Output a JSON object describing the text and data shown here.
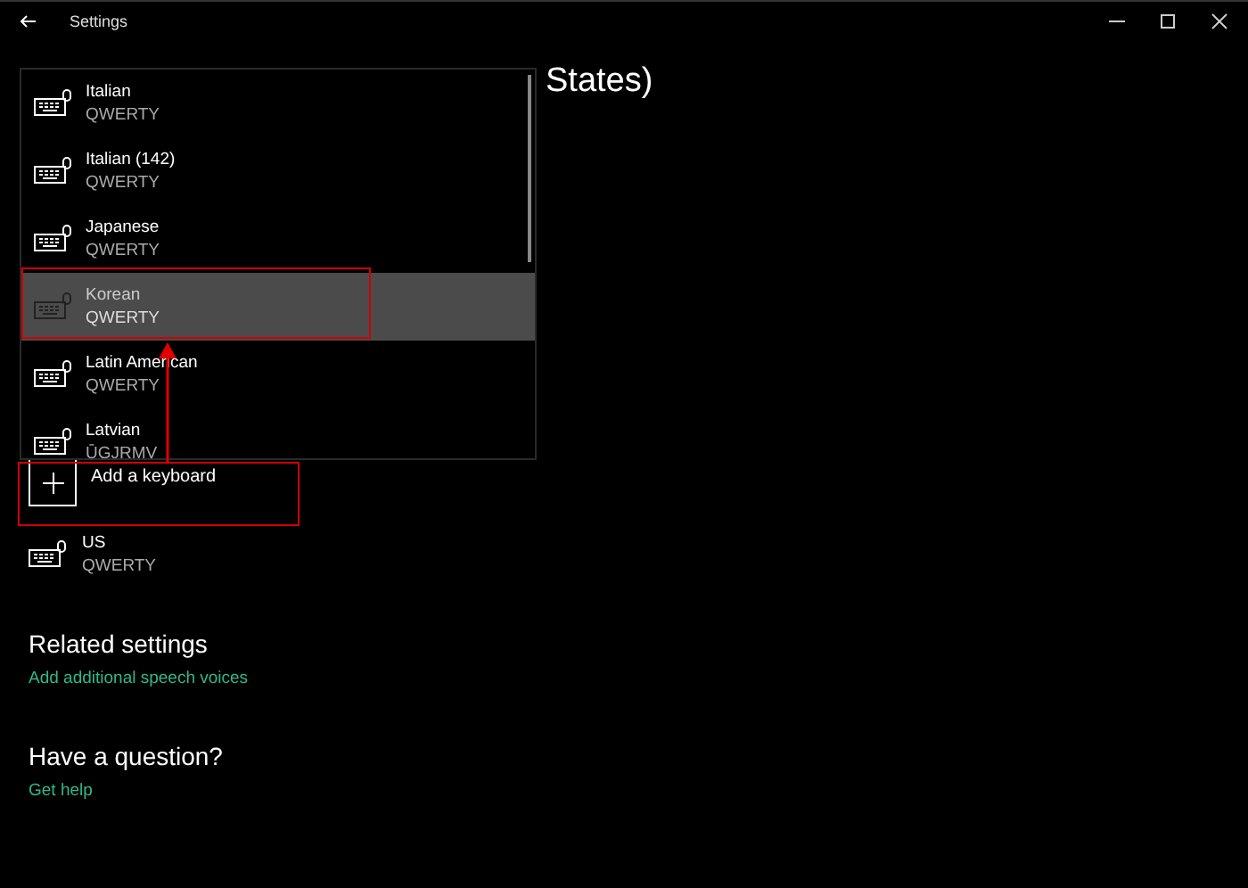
{
  "window": {
    "title": "Settings"
  },
  "page_heading": "States)",
  "keyboard_dropdown": {
    "items": [
      {
        "name": "Italian",
        "layout": "QWERTY",
        "selected": false
      },
      {
        "name": "Italian (142)",
        "layout": "QWERTY",
        "selected": false
      },
      {
        "name": "Japanese",
        "layout": "QWERTY",
        "selected": false
      },
      {
        "name": "Korean",
        "layout": "QWERTY",
        "selected": true
      },
      {
        "name": "Latin American",
        "layout": "QWERTY",
        "selected": false
      },
      {
        "name": "Latvian",
        "layout": "ŪGJRMV",
        "selected": false
      }
    ]
  },
  "add_keyboard": {
    "label": "Add a keyboard"
  },
  "keyboards": [
    {
      "name": "US",
      "layout": "QWERTY"
    }
  ],
  "related_settings": {
    "heading": "Related settings",
    "links": [
      "Add additional speech voices"
    ]
  },
  "help": {
    "heading": "Have a question?",
    "links": [
      "Get help"
    ]
  }
}
